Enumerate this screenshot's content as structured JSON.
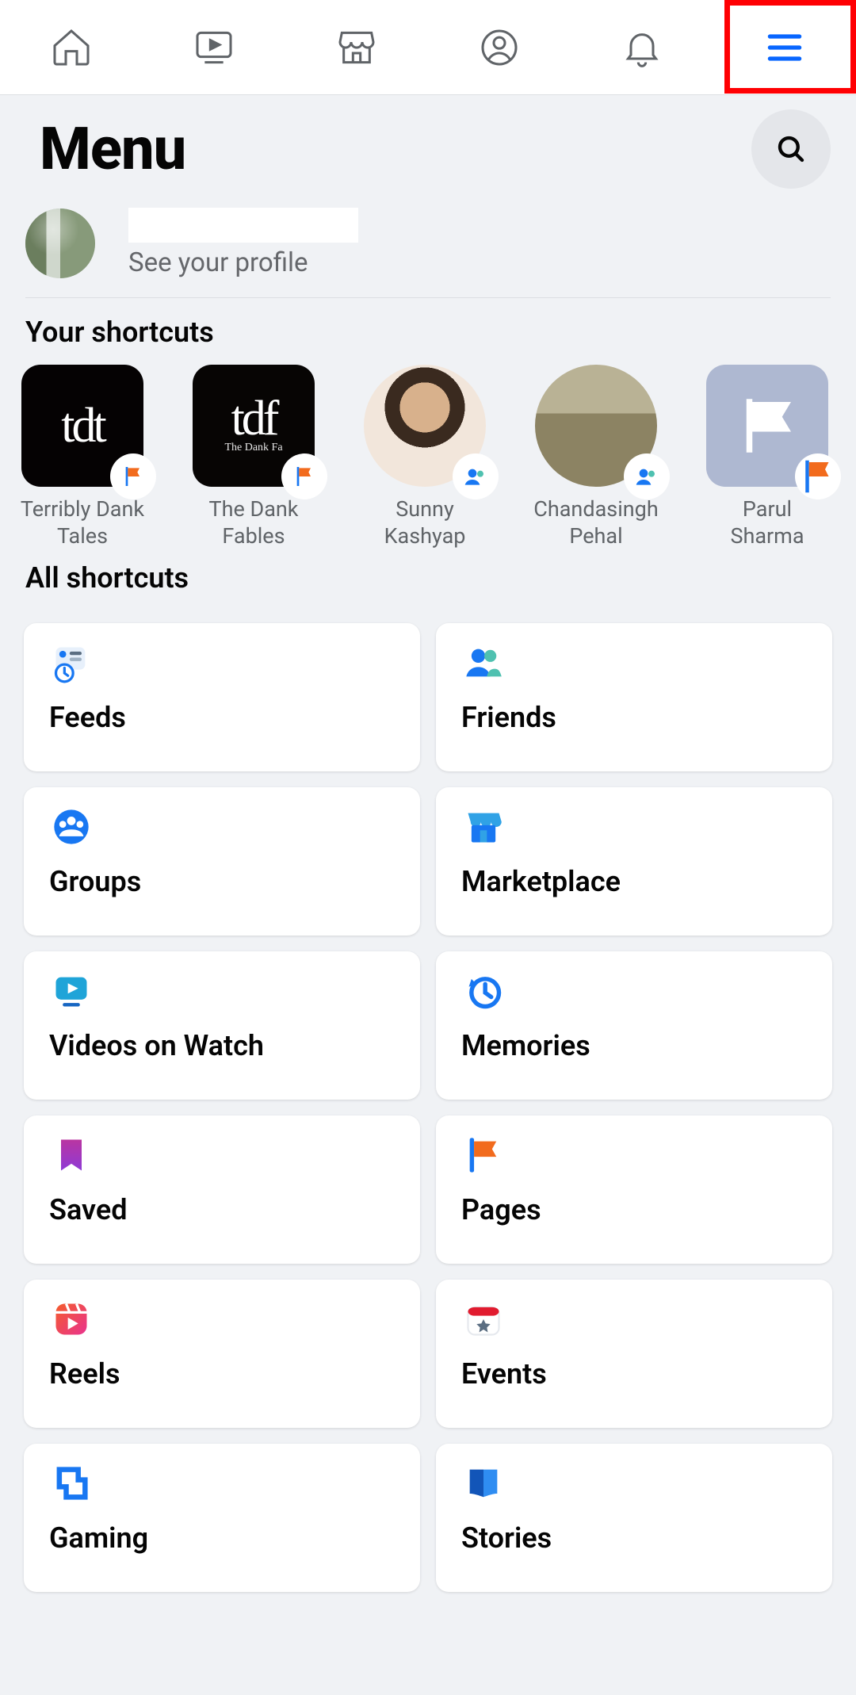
{
  "tabs": [
    "home",
    "watch",
    "marketplace",
    "profile",
    "notifications",
    "menu"
  ],
  "highlighted_tab": "menu",
  "title": "Menu",
  "profile": {
    "subtitle": "See your profile"
  },
  "your_shortcuts_heading": "Your shortcuts",
  "all_shortcuts_heading": "All shortcuts",
  "shortcuts": [
    {
      "label": "Terribly Dank Tales",
      "thumb_text": "tdt",
      "badge": "page-flag"
    },
    {
      "label": "The Dank Fables",
      "thumb_text": "tdf",
      "badge": "page-flag"
    },
    {
      "label": "Sunny Kashyap",
      "thumb_text": "",
      "badge": "group"
    },
    {
      "label": "Chandasingh Pehal",
      "thumb_text": "",
      "badge": "group"
    },
    {
      "label": "Parul Sharma",
      "thumb_text": "",
      "badge": "page-flag"
    }
  ],
  "cards": [
    {
      "label": "Feeds",
      "icon": "feeds"
    },
    {
      "label": "Friends",
      "icon": "friends"
    },
    {
      "label": "Groups",
      "icon": "groups"
    },
    {
      "label": "Marketplace",
      "icon": "marketplace"
    },
    {
      "label": "Videos on Watch",
      "icon": "watch"
    },
    {
      "label": "Memories",
      "icon": "memories"
    },
    {
      "label": "Saved",
      "icon": "saved"
    },
    {
      "label": "Pages",
      "icon": "pages"
    },
    {
      "label": "Reels",
      "icon": "reels"
    },
    {
      "label": "Events",
      "icon": "events"
    },
    {
      "label": "Gaming",
      "icon": "gaming"
    },
    {
      "label": "Stories",
      "icon": "stories"
    }
  ]
}
